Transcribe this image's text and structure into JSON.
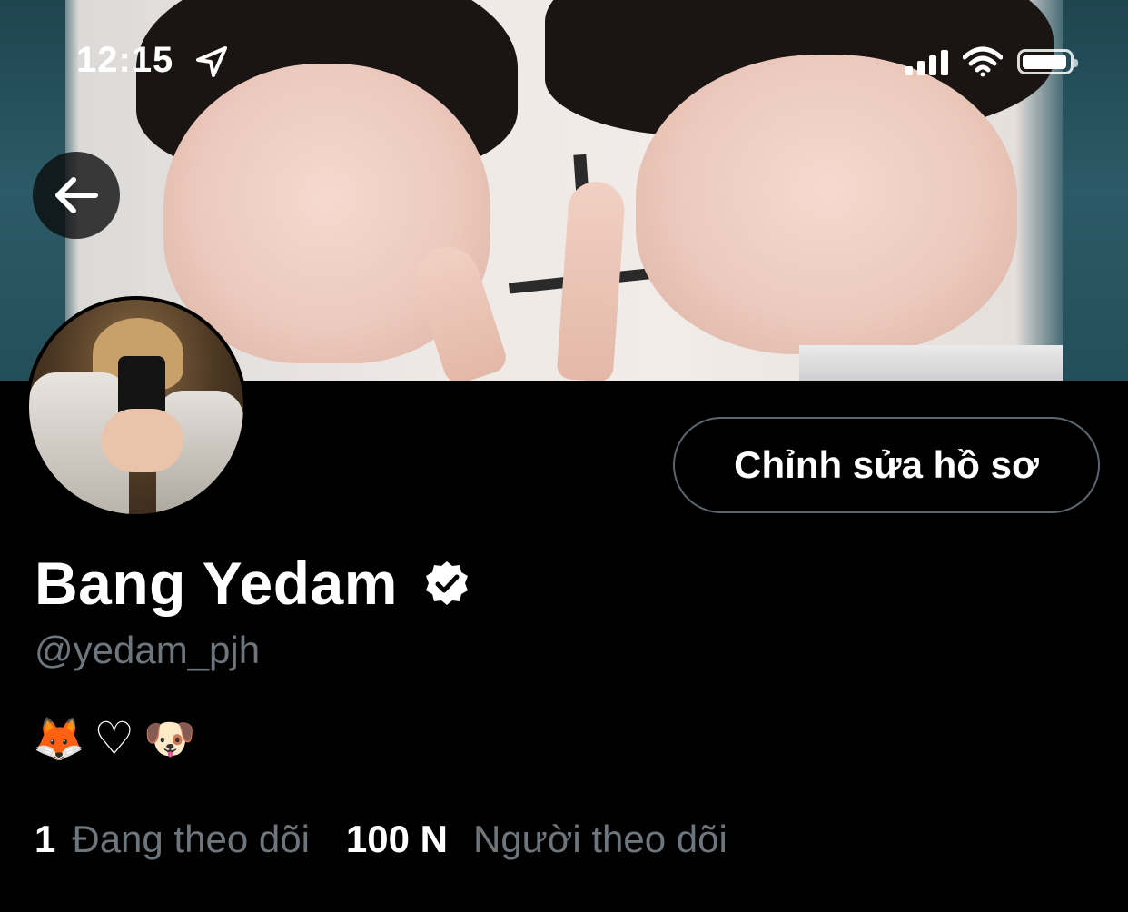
{
  "status_bar": {
    "time": "12:15"
  },
  "profile": {
    "display_name": "Bang Yedam",
    "handle": "@yedam_pjh",
    "bio_emojis": [
      "🦊",
      "♡",
      "🐶"
    ],
    "edit_button_label": "Chỉnh sửa hồ sơ"
  },
  "stats": {
    "following_count": "1",
    "following_label": "Đang theo dõi",
    "followers_count": "100 N",
    "followers_label": "Người theo dõi"
  },
  "colors": {
    "background": "#000000",
    "secondary_text": "#6e767d",
    "button_border": "#5b6670"
  }
}
